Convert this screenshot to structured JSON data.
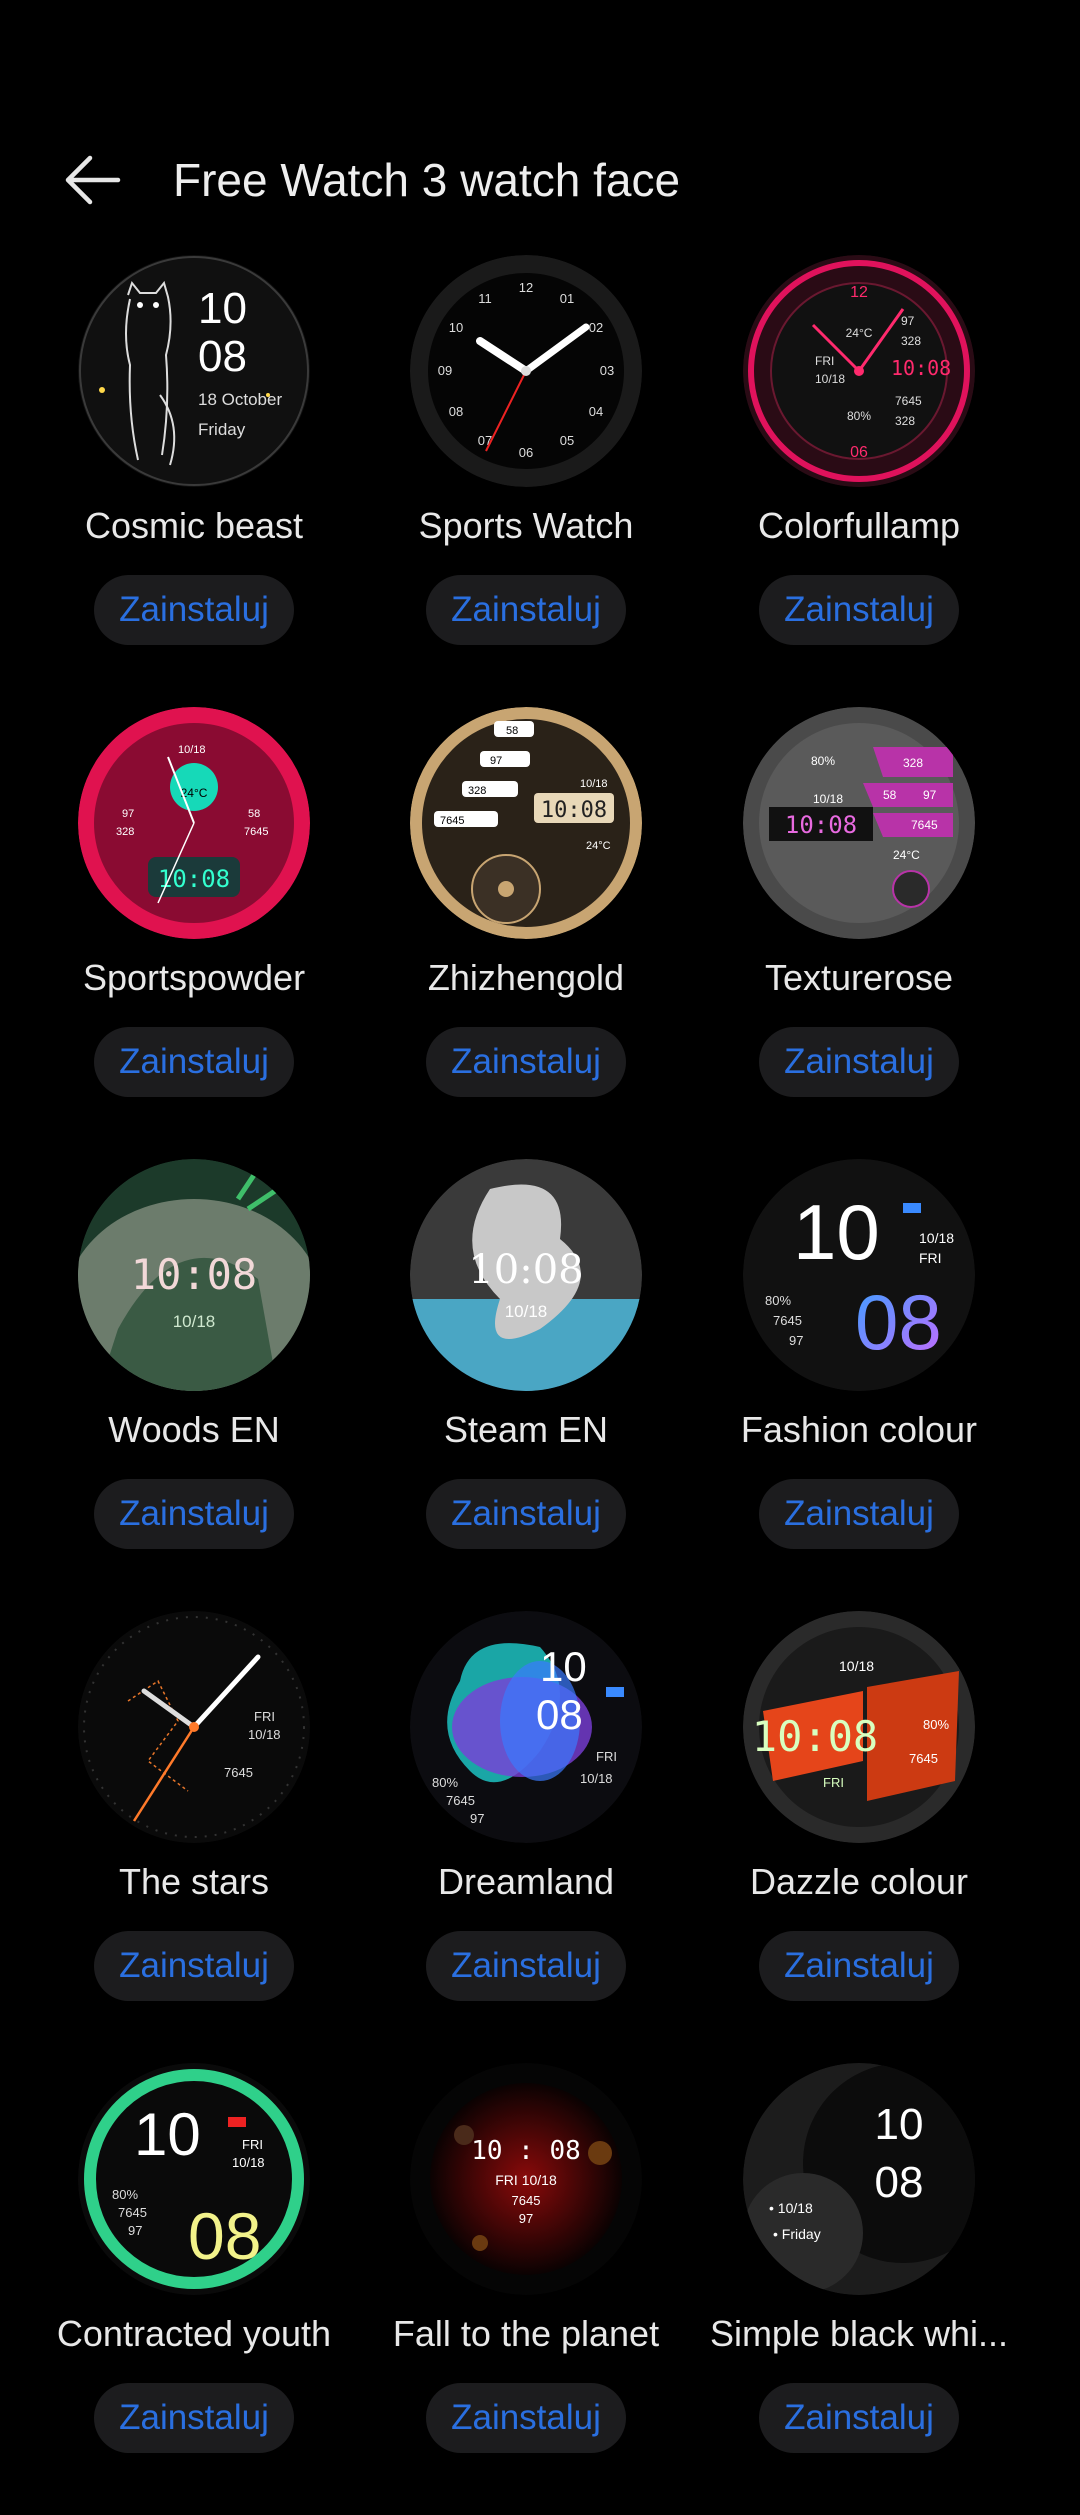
{
  "header": {
    "title": "Free Watch 3 watch face",
    "back_icon": "arrow-left-icon"
  },
  "install_label": "Zainstaluj",
  "faces": [
    {
      "id": "cosmic-beast",
      "name": "Cosmic beast",
      "hour": "10",
      "minute": "08",
      "date": "18  October",
      "day": "Friday"
    },
    {
      "id": "sports-watch",
      "name": "Sports Watch",
      "numerals": [
        "12",
        "01",
        "02",
        "03",
        "04",
        "05",
        "06",
        "07",
        "08",
        "09",
        "10",
        "11"
      ]
    },
    {
      "id": "colorfullamp",
      "name": "Colorfullamp",
      "time": "10:08",
      "date": "10/18",
      "day": "FRI",
      "temp": "24°C",
      "steps": "7645",
      "heart": "97",
      "battery": "80%",
      "calories": "328",
      "top": "12",
      "bottom": "06"
    },
    {
      "id": "sportspowder",
      "name": "Sportspowder",
      "time": "10:08",
      "date": "10/18",
      "temp": "24°C",
      "heart": "97",
      "calories": "328",
      "steps": "7645",
      "battery_num": "58"
    },
    {
      "id": "zhizhengold",
      "name": "Zhizhengold",
      "time": "10:08",
      "date": "10/18",
      "temp": "24°C",
      "heart": "97",
      "calories": "328",
      "steps": "7645",
      "battery_num": "58"
    },
    {
      "id": "texturerose",
      "name": "Texturerose",
      "time": "10:08",
      "date": "10/18",
      "temp": "24°C",
      "battery": "80%",
      "calories": "328",
      "steps": "7645",
      "heart": "97",
      "battery_num": "58"
    },
    {
      "id": "woods-en",
      "name": "Woods EN",
      "time": "10:08",
      "date": "10/18"
    },
    {
      "id": "steam-en",
      "name": "Steam EN",
      "time": "10:08",
      "date": "10/18"
    },
    {
      "id": "fashion-colour",
      "name": "Fashion colour",
      "hour": "10",
      "minute": "08",
      "date": "10/18",
      "day": "FRI",
      "battery": "80%",
      "steps": "7645",
      "heart": "97"
    },
    {
      "id": "the-stars",
      "name": "The stars",
      "day": "FRI",
      "date": "10/18",
      "steps": "7645"
    },
    {
      "id": "dreamland",
      "name": "Dreamland",
      "hour": "10",
      "minute": "08",
      "day": "FRI",
      "date": "10/18",
      "battery": "80%",
      "steps": "7645",
      "heart": "97"
    },
    {
      "id": "dazzle-colour",
      "name": "Dazzle colour",
      "time": "10:08",
      "date": "10/18",
      "day": "FRI",
      "battery": "80%",
      "steps": "7645"
    },
    {
      "id": "contracted-youth",
      "name": "Contracted youth",
      "hour": "10",
      "minute": "08",
      "day": "FRI",
      "date": "10/18",
      "battery": "80%",
      "steps": "7645",
      "heart": "97"
    },
    {
      "id": "fall-to-the-planet",
      "name": "Fall to the planet",
      "time": "10 : 08",
      "dayline": "FRI  10/18",
      "steps": "7645",
      "heart": "97"
    },
    {
      "id": "simple-black-white",
      "name": "Simple black whi...",
      "hour": "10",
      "minute": "08",
      "date": "• 10/18",
      "day": "• Friday"
    }
  ],
  "colors": {
    "accent": "#2a6fe0",
    "pill_bg": "#1c1c1e",
    "background": "#000000"
  }
}
